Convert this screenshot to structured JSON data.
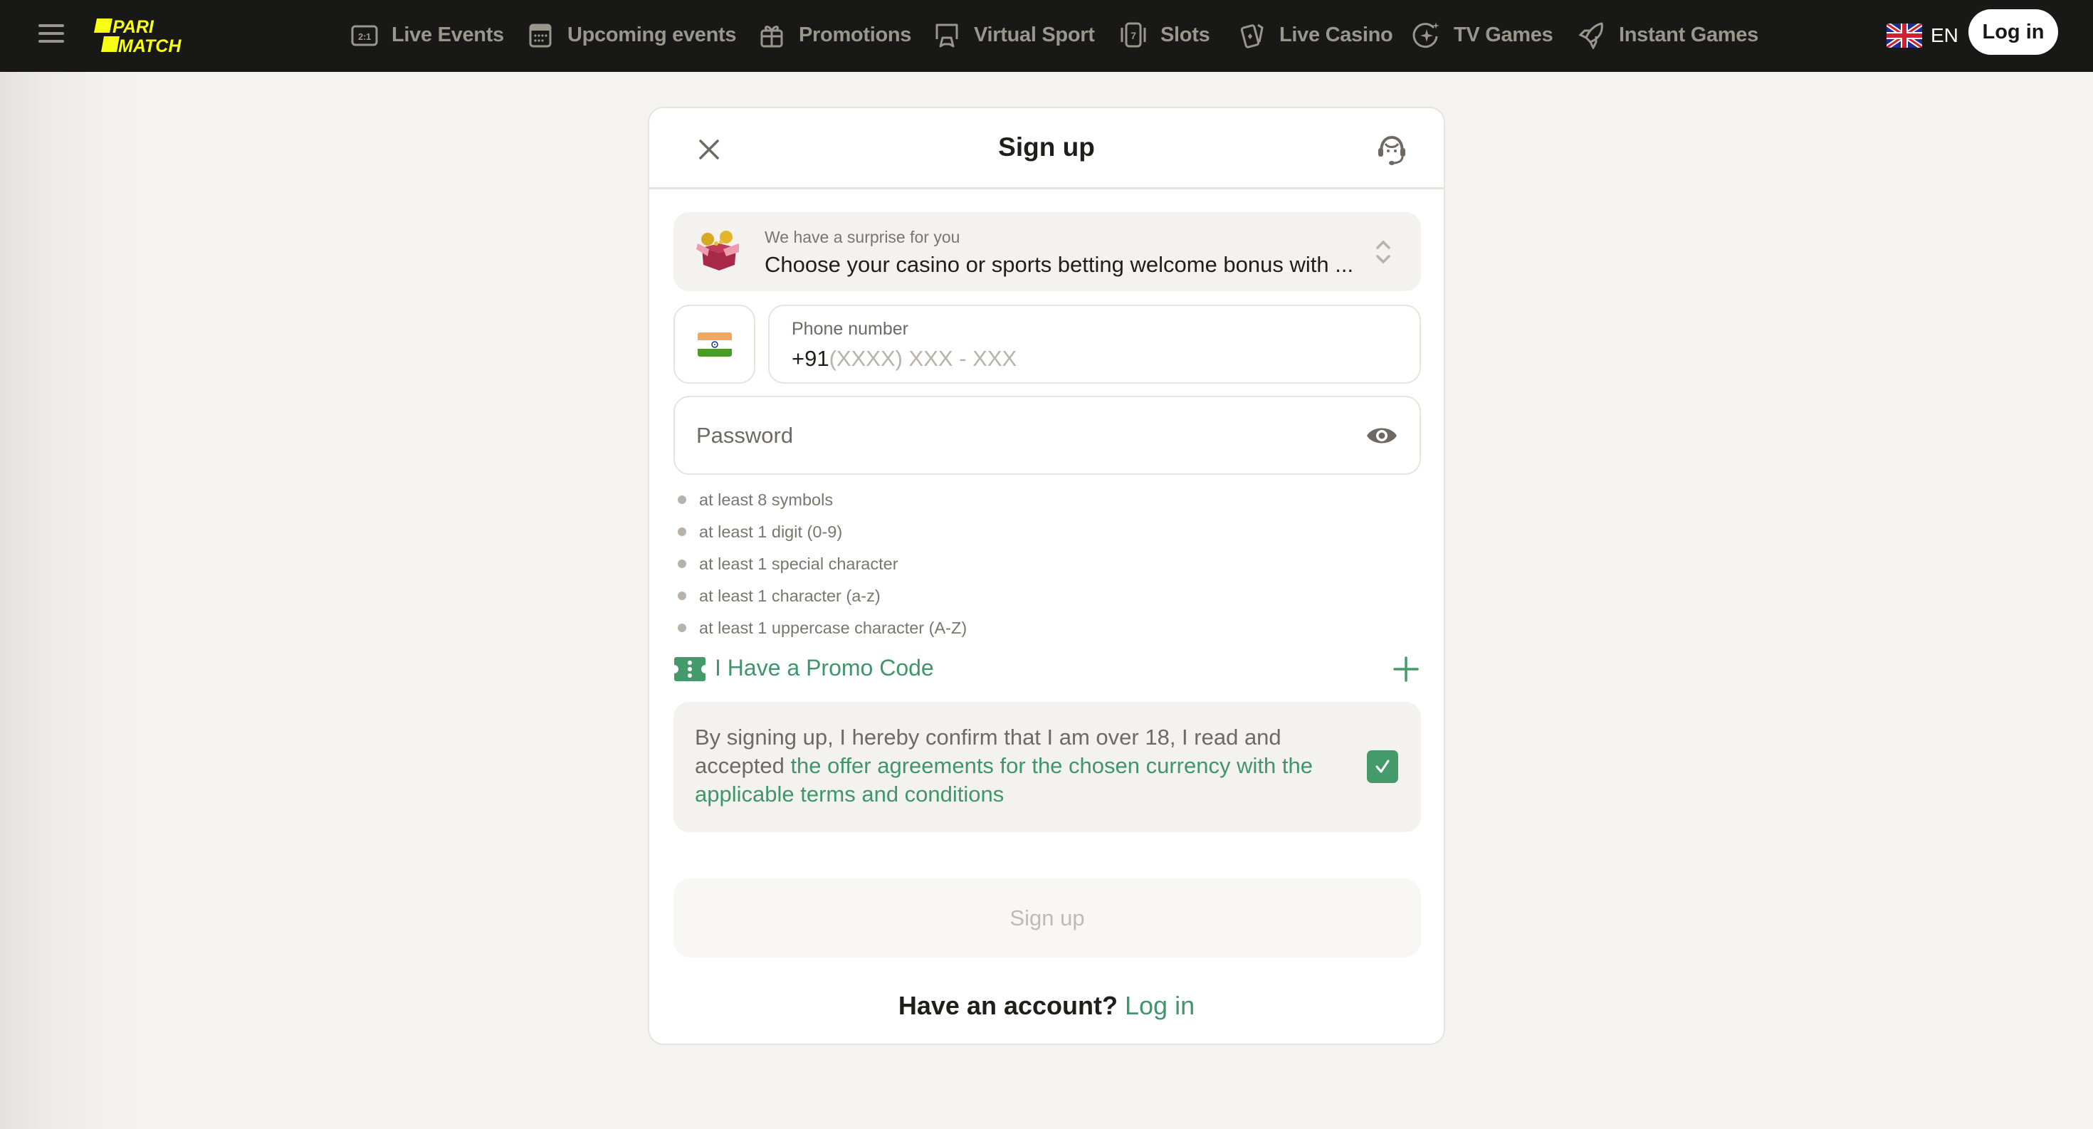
{
  "navbar": {
    "brand": "PARIMATCH",
    "items": [
      {
        "label": "Live Events",
        "icon": "scoreboard-icon"
      },
      {
        "label": "Upcoming events",
        "icon": "calendar-icon"
      },
      {
        "label": "Promotions",
        "icon": "gift-icon"
      },
      {
        "label": "Virtual Sport",
        "icon": "gamepad-icon"
      },
      {
        "label": "Slots",
        "icon": "slot-machine-icon"
      },
      {
        "label": "Live Casino",
        "icon": "playing-cards-icon"
      },
      {
        "label": "TV Games",
        "icon": "sparkle-icon"
      },
      {
        "label": "Instant Games",
        "icon": "rocket-icon"
      }
    ],
    "language": "EN",
    "login_label": "Log in"
  },
  "modal": {
    "title": "Sign up",
    "bonus": {
      "subtitle": "We have a surprise for you",
      "selected": "Choose your casino or sports betting welcome bonus with ..."
    },
    "phone": {
      "label": "Phone number",
      "prefix": "+91",
      "placeholder": "(XXXX) XXX - XXX",
      "country": "India"
    },
    "password": {
      "placeholder": "Password"
    },
    "password_rules": [
      "at least 8 symbols",
      "at least 1 digit (0-9)",
      "at least 1 special character",
      "at least 1 character (a-z)",
      "at least 1 uppercase character (A-Z)"
    ],
    "promo_label": "I Have a Promo Code",
    "terms": {
      "text_before": "By signing up, I hereby confirm that I am over 18, I read and accepted ",
      "link_text": "the offer agreements for the chosen currency with the applicable terms and conditions",
      "checked": true
    },
    "submit_label": "Sign up",
    "have_account": "Have an account?",
    "login_link": "Log in"
  },
  "colors": {
    "navbar_bg": "#181816",
    "brand_yellow": "#f8ff13",
    "accent_green": "#3f966a",
    "page_bg": "#f4f3ef"
  }
}
